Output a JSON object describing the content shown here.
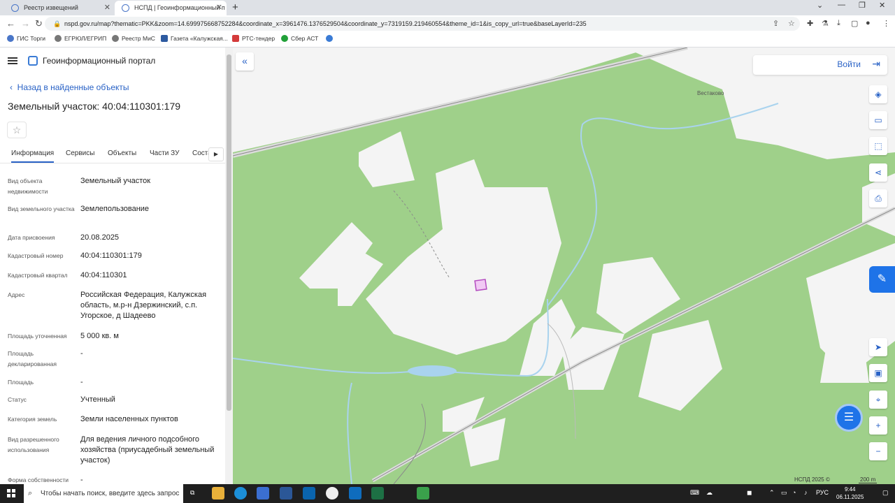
{
  "browser": {
    "tabs": [
      {
        "label": "Реестр извещений"
      },
      {
        "label": "НСПД | Геоинформационный п"
      }
    ],
    "url": "nspd.gov.ru/map?thematic=PKK&zoom=14.699975668752284&coordinate_x=3961476.1376529504&coordinate_y=7319159.219460554&theme_id=1&is_copy_url=true&baseLayerId=235",
    "bookmarks": [
      "ГИС Торги",
      "ЕГРЮЛ/ЕГРИП",
      "Реестр МиС",
      "Газета «Калужская...",
      "РТС-тендер",
      "Сбер АСТ"
    ]
  },
  "sidebar": {
    "portal_title": "Геоинформационный портал",
    "back_link": "Назад в найденные объекты",
    "object_title": "Земельный участок: 40:04:110301:179",
    "tabs": [
      "Информация",
      "Сервисы",
      "Объекты",
      "Части ЗУ",
      "Соста"
    ],
    "properties": [
      {
        "label": "Вид объекта недвижимости",
        "value": "Земельный участок"
      },
      {
        "label": "Вид земельного участка",
        "value": "Землепользование"
      },
      {
        "label": "Дата присвоения",
        "value": "20.08.2025"
      },
      {
        "label": "Кадастровый номер",
        "value": "40:04:110301:179"
      },
      {
        "label": "Кадастровый квартал",
        "value": "40:04:110301"
      },
      {
        "label": "Адрес",
        "value": "Российская Федерация, Калужская область, м.р-н Дзержинский, с.п. Угорское, д Шадеево"
      },
      {
        "label": "Площадь уточненная",
        "value": "5 000 кв. м"
      },
      {
        "label": "Площадь декларированная",
        "value": "-"
      },
      {
        "label": "Площадь",
        "value": "-"
      },
      {
        "label": "Статус",
        "value": "Учтенный"
      },
      {
        "label": "Категория земель",
        "value": "Земли населенных пунктов"
      },
      {
        "label": "Вид разрешенного использования",
        "value": "Для ведения личного подсобного хозяйства (приусадебный земельный участок)"
      },
      {
        "label": "Форма собственности",
        "value": "-"
      }
    ]
  },
  "map": {
    "login_label": "Войти",
    "place_label": "Вестаково",
    "attribution": "НСПД 2025 ©",
    "scale_label": "200 m",
    "colors": {
      "forest": "#9fd08a",
      "open": "#f4f4f4",
      "water": "#a9d3ee",
      "parcel": "#d987e0"
    }
  },
  "taskbar": {
    "search_placeholder": "Чтобы начать поиск, введите здесь запрос",
    "lang": "РУС",
    "time": "9:44",
    "date": "06.11.2025"
  }
}
